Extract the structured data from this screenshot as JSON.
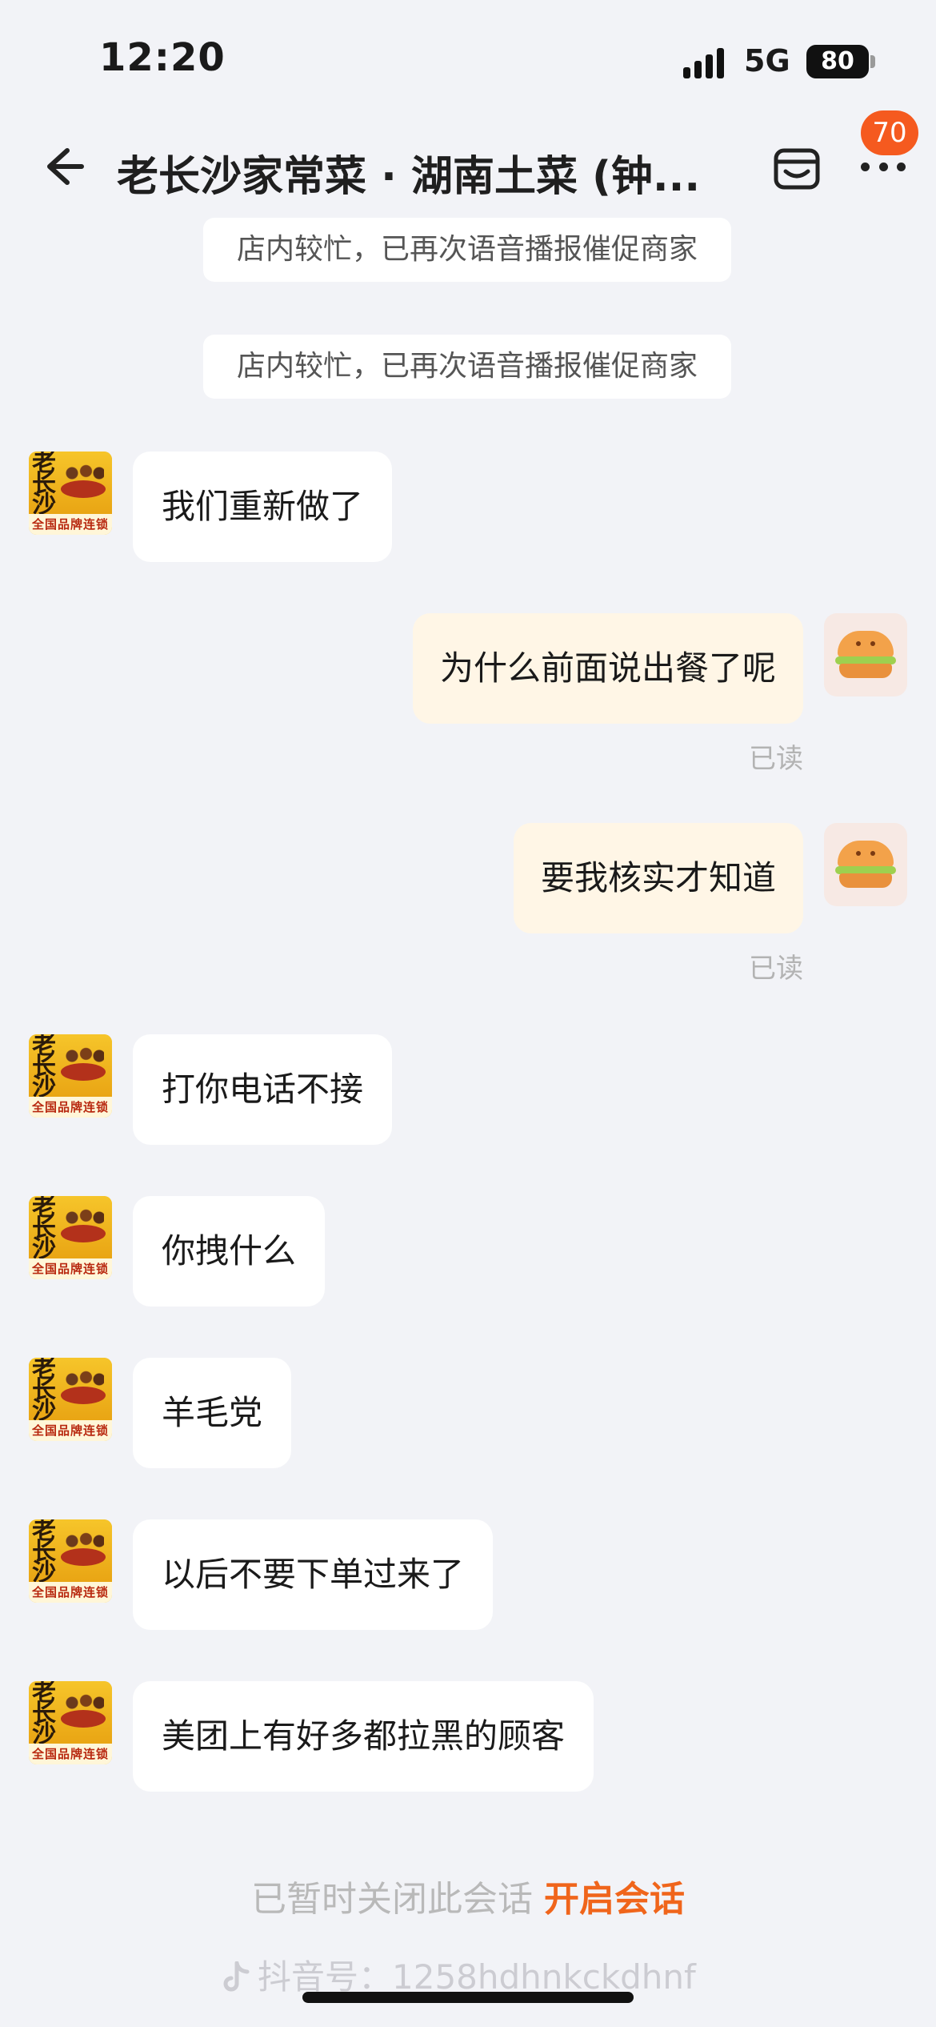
{
  "status_bar": {
    "time": "12:20",
    "network": "5G",
    "battery": "80",
    "signal_icon": "signal-bars-icon"
  },
  "header": {
    "title": "老长沙家常菜 · 湖南土菜 (钟...",
    "badge": "70",
    "back_icon": "back-arrow-icon",
    "shop_icon": "shop-icon",
    "more_icon": "more-icon"
  },
  "system_tips": [
    "店内较忙，已再次语音播报催促商家",
    "店内较忙，已再次语音播报催促商家"
  ],
  "avatar": {
    "shop_chars": "老长沙",
    "shop_tagline": "全国品牌连锁"
  },
  "messages": [
    {
      "side": "left",
      "text": "我们重新做了"
    },
    {
      "side": "right",
      "text": "为什么前面说出餐了呢",
      "status": "已读"
    },
    {
      "side": "right",
      "text": "要我核实才知道",
      "status": "已读"
    },
    {
      "side": "left",
      "text": "打你电话不接"
    },
    {
      "side": "left",
      "text": "你拽什么"
    },
    {
      "side": "left",
      "text": "羊毛党"
    },
    {
      "side": "left",
      "text": "以后不要下单过来了"
    },
    {
      "side": "left",
      "text": "美团上有好多都拉黑的顾客"
    }
  ],
  "footer": {
    "closed_text": "已暂时关闭此会话",
    "open_link": "开启会话"
  },
  "watermark": {
    "text": "抖音号：1258hdhnkckdhnf"
  },
  "colors": {
    "accent": "#f0651b",
    "badge": "#f55a1f",
    "bubble_right": "#fff6e6",
    "bubble_left": "#ffffff",
    "background": "#f2f3f7"
  }
}
